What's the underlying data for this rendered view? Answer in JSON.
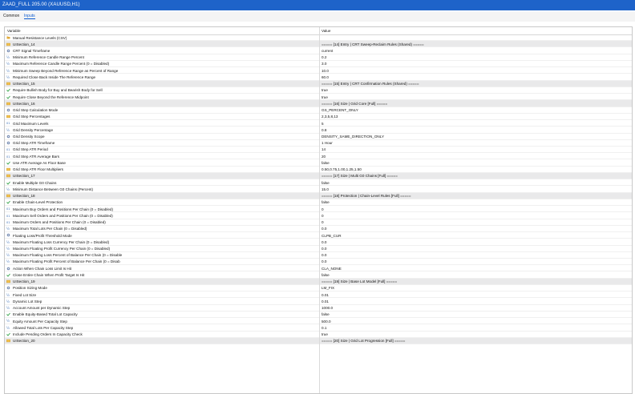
{
  "window": {
    "title": "ZAAD_FULL 205.00 (XAUUSD,H1)"
  },
  "tabs": [
    {
      "label": "Common",
      "active": false
    },
    {
      "label": "Inputs",
      "active": true
    }
  ],
  "table": {
    "headers": [
      "Variable",
      "Value"
    ],
    "rows": [
      {
        "icon": "folder-icon",
        "name": "Manual Resistance Levels (CSV)",
        "value": ""
      },
      {
        "icon": "ab-icon",
        "name": "UISection_14",
        "value": "===== [14] Entry | CRT Sweep-Reclaim Rules (Shared) ====="
      },
      {
        "icon": "enum-icon",
        "name": "CRT Signal Timeframe",
        "value": "current"
      },
      {
        "icon": "fraction-icon",
        "name": "Minimum Reference Candle Range Percent",
        "value": "0.2"
      },
      {
        "icon": "fraction-icon",
        "name": "Maximum Reference Candle Range Percent (0 = Disabled)",
        "value": "3.0"
      },
      {
        "icon": "fraction-icon",
        "name": "Minimum Sweep Beyond Reference Range as Percent of Range",
        "value": "10.0"
      },
      {
        "icon": "fraction-icon",
        "name": "Required Close Back Inside The Reference Range",
        "value": "60.0"
      },
      {
        "icon": "ab-icon",
        "name": "UISection_15",
        "value": "===== [15] Entry | CRT Confirmation Rules (Shared) ====="
      },
      {
        "icon": "bool-icon",
        "name": "Require Bullish Body for Buy and Bearish Body for Sell",
        "value": "true"
      },
      {
        "icon": "bool-icon",
        "name": "Require Close Beyond the Reference Midpoint",
        "value": "true"
      },
      {
        "icon": "ab-icon",
        "name": "UISection_16",
        "value": "===== [16] Size | Grid Core [Full] ====="
      },
      {
        "icon": "enum-icon",
        "name": "Grid Step Calculation Mode",
        "value": "GS_PERCENT_ONLY"
      },
      {
        "icon": "ab-icon",
        "name": "Grid Step Percentages",
        "value": "2,3,5,8,13"
      },
      {
        "icon": "int-icon",
        "name": "Grid Maximum Levels",
        "value": "5"
      },
      {
        "icon": "fraction-icon",
        "name": "Grid Density Percentage",
        "value": "0.8"
      },
      {
        "icon": "enum-icon",
        "name": "Grid Density Scope",
        "value": "DENSITY_SAME_DIRECTION_ONLY"
      },
      {
        "icon": "enum-icon",
        "name": "Grid Step ATR Timeframe",
        "value": "1 Hour"
      },
      {
        "icon": "int-icon",
        "name": "Grid Step ATR Period",
        "value": "14"
      },
      {
        "icon": "int-icon",
        "name": "Grid Step ATR Average Bars",
        "value": "20"
      },
      {
        "icon": "bool-icon",
        "name": "Use ATR Average As Floor Base",
        "value": "false"
      },
      {
        "icon": "ab-icon",
        "name": "Grid Step ATR Floor Multipliers",
        "value": "0.50,0.75,1.00,1.25,1.50"
      },
      {
        "icon": "ab-icon",
        "name": "UISection_17",
        "value": "===== [17] Size | Multi G0 Chains [Full] ====="
      },
      {
        "icon": "bool-icon",
        "name": "Enable Multiple G0 Chains",
        "value": "false"
      },
      {
        "icon": "fraction-icon",
        "name": "Minimum Distance Between G0 Chains (Percent)",
        "value": "15.0"
      },
      {
        "icon": "ab-icon",
        "name": "UISection_18",
        "value": "===== [18] Protection | Chain-Level Rules [Full] ====="
      },
      {
        "icon": "bool-icon",
        "name": "Enable Chain-Level Protection",
        "value": "false"
      },
      {
        "icon": "int-icon",
        "name": "Maximum Buy Orders and Positions Per Chain (0 = Disabled)",
        "value": "0"
      },
      {
        "icon": "int-icon",
        "name": "Maximum Sell Orders and Positions Per Chain (0 = Disabled)",
        "value": "0"
      },
      {
        "icon": "int-icon",
        "name": "Maximum Orders and Positions Per Chain (0 = Disabled)",
        "value": "0"
      },
      {
        "icon": "fraction-icon",
        "name": "Maximum Total Lots Per Chain (0 = Disabled)",
        "value": "0.0"
      },
      {
        "icon": "enum-icon",
        "name": "Floating Loss/Profit Threshold Mode",
        "value": "CLPB_CUR"
      },
      {
        "icon": "fraction-icon",
        "name": "Maximum Floating Loss Currency Per Chain (0 = Disabled)",
        "value": "0.0"
      },
      {
        "icon": "fraction-icon",
        "name": "Maximum Floating Profit Currency Per Chain (0 = Disabled)",
        "value": "0.0"
      },
      {
        "icon": "fraction-icon",
        "name": "Maximum Floating Loss Percent of Balance Per Chain (0 = Disable",
        "value": "0.0"
      },
      {
        "icon": "fraction-icon",
        "name": "Maximum Floating Profit Percent of Balance Per Chain (0 = Disab",
        "value": "0.0"
      },
      {
        "icon": "enum-icon",
        "name": "Action When Chain Loss Limit Is Hit",
        "value": "CLA_NONE"
      },
      {
        "icon": "bool-icon",
        "name": "Close Entire Chain When Profit Target Is Hit",
        "value": "false"
      },
      {
        "icon": "ab-icon",
        "name": "UISection_19",
        "value": "===== [19] Size | Base Lot Model [Full] ====="
      },
      {
        "icon": "enum-icon",
        "name": "Position Sizing Mode",
        "value": "LM_FIX"
      },
      {
        "icon": "fraction-icon",
        "name": "Fixed Lot Size",
        "value": "0.01"
      },
      {
        "icon": "fraction-icon",
        "name": "Dynamic Lot Step",
        "value": "0.01"
      },
      {
        "icon": "fraction-icon",
        "name": "Account Amount per Dynamic Step",
        "value": "1000.0"
      },
      {
        "icon": "bool-icon",
        "name": "Enable Equity-Based Total Lot Capacity",
        "value": "false"
      },
      {
        "icon": "fraction-icon",
        "name": "Equity Amount Per Capacity Step",
        "value": "500.0"
      },
      {
        "icon": "fraction-icon",
        "name": "Allowed Total Lots Per Capacity Step",
        "value": "0.1"
      },
      {
        "icon": "bool-icon",
        "name": "Include Pending Orders In Capacity Check",
        "value": "true"
      },
      {
        "icon": "ab-icon",
        "name": "UISection_20",
        "value": "===== [20] Size | Grid Lot Progression [Full] ====="
      }
    ]
  }
}
